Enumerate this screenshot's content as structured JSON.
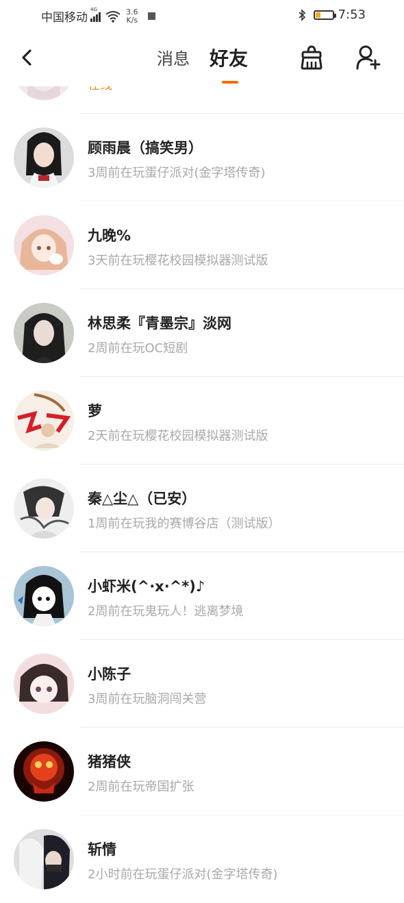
{
  "status_bar": {
    "carrier": "中国移动",
    "network_tag": "4G",
    "speed_value": "3.6",
    "speed_unit": "K/s",
    "time": "7:53",
    "battery_level": 0.3
  },
  "nav": {
    "tabs": [
      {
        "label": "消息",
        "active": false
      },
      {
        "label": "好友",
        "active": true
      }
    ],
    "accent_color": "#ff6a00"
  },
  "partial_top": {
    "status": "在线"
  },
  "friends": [
    {
      "name": "顾雨晨（搞笑男）",
      "status": "3周前在玩蛋仔派对(金字塔传奇)"
    },
    {
      "name": "九晚%",
      "status": "3天前在玩樱花校园模拟器测试版"
    },
    {
      "name": "林思柔『青墨宗』淡网",
      "status": "2周前在玩OC短剧"
    },
    {
      "name": "萝",
      "status": "2天前在玩樱花校园模拟器测试版"
    },
    {
      "name": "秦△尘△（已安）",
      "status": "1周前在玩我的赛博谷店（测试版）"
    },
    {
      "name": "小虾米(^·x·^*)♪",
      "status": "2周前在玩鬼玩人！逃离梦境"
    },
    {
      "name": "小陈子",
      "status": "3周前在玩脑洞闯关营"
    },
    {
      "name": "猪猪侠",
      "status": "2周前在玩帝国扩张"
    },
    {
      "name": "斩情",
      "status": "2小时前在玩蛋仔派对(金字塔传奇)"
    }
  ]
}
